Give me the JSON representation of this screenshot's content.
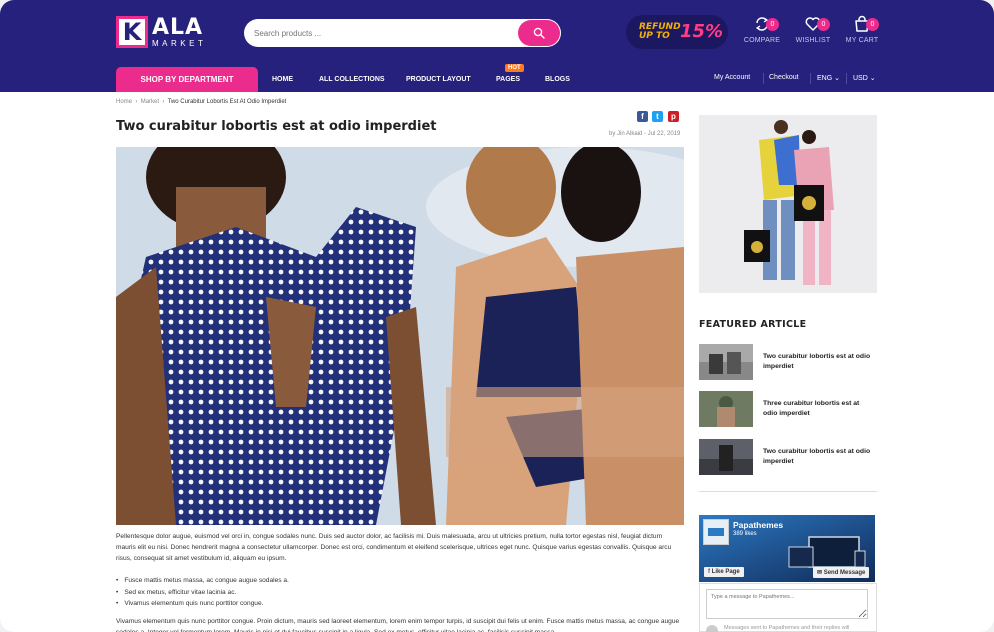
{
  "brand": {
    "logo_letter": "K",
    "logo_name": "ALA",
    "logo_sub": "MARKET",
    "accent": "#ec2c8c",
    "header_bg": "#25217c"
  },
  "search": {
    "placeholder": "Search products ..."
  },
  "promo": {
    "text": "REFUND UP TO",
    "percent": "15%"
  },
  "header_icons": [
    {
      "icon": "compare-icon",
      "label": "COMPARE",
      "count": "0"
    },
    {
      "icon": "heart-icon",
      "label": "WISHLIST",
      "count": "0"
    },
    {
      "icon": "cart-icon",
      "label": "MY CART",
      "count": "0"
    }
  ],
  "nav": {
    "shop_by_department": "SHOP BY DEPARTMENT",
    "items": [
      "HOME",
      "ALL COLLECTIONS",
      "PRODUCT LAYOUT",
      "PAGES",
      "BLOGS"
    ],
    "hot_badge": "HOT",
    "util": {
      "account": "My Account",
      "checkout": "Checkout",
      "language": "ENG",
      "currency": "USD"
    }
  },
  "breadcrumb": {
    "home": "Home",
    "section": "Market",
    "current": "Two Curabitur Lobortis Est At Odio Imperdiet"
  },
  "article": {
    "title": "Two curabitur lobortis est at odio imperdiet",
    "byline": "by Jin Alkaid - Jul 22, 2019",
    "share": [
      "f",
      "t",
      "p"
    ],
    "paragraph1": "Pellentesque dolor augue, euismod vel orci in, congue sodales nunc. Duis sed auctor dolor, ac facilisis mi. Duis malesuada, arcu ut ultricies pretium, nulla tortor egestas nisl, feugiat dictum mauris elit eu nisi. Donec hendrerit magna a consectetur ullamcorper. Donec est orci, condimentum et eleifend scelerisque, ultrices eget nunc. Quisque varius egestas convallis. Quisque arcu risus, consequat sit amet vestibulum id, aliquam eu ipsum.",
    "bullets": [
      "Fusce mattis metus massa, ac congue augue sodales a.",
      "Sed ex metus, efficitur vitae lacinia ac.",
      "Vivamus elementum quis nunc porttitor congue."
    ],
    "paragraph2": "Vivamus elementum quis nunc porttitor congue. Proin dictum, mauris sed laoreet elementum, lorem enim tempor turpis, id suscipit dui felis ut enim. Fusce mattis metus massa, ac congue augue sodales a. Integer vel fermentum lorem. Mauris in nisi et dui faucibus suscipit in a ligula. Sed ex metus, efficitur vitae lacinia ac, facilisis suscipit massa."
  },
  "sidebar": {
    "featured_title": "FEATURED ARTICLE",
    "articles": [
      {
        "title": "Two curabitur lobortis est at odio imperdiet"
      },
      {
        "title": "Three curabitur lobortis est at odio imperdiet"
      },
      {
        "title": "Two curabitur lobortis est at odio imperdiet"
      }
    ],
    "facebook": {
      "page_name": "Papathemes",
      "likes": "389 likes",
      "like_button": "Like Page",
      "send_button": "Send Message"
    },
    "message": {
      "placeholder": "Type a message to Papathemes...",
      "note": "Messages sent to Papathemes and their replies will"
    }
  }
}
